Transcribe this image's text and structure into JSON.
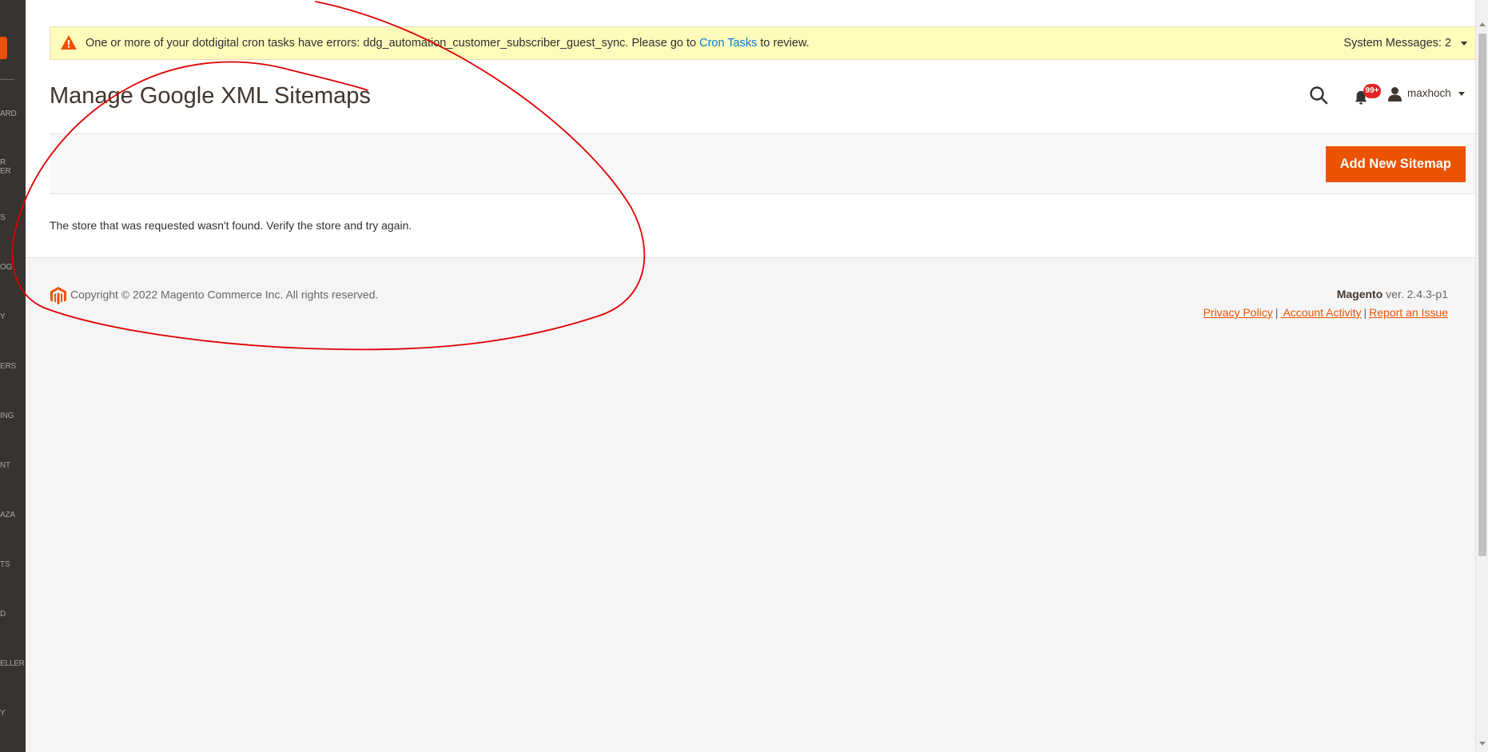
{
  "sidebar": {
    "items": [
      {
        "label": "ARD"
      },
      {
        "label": "R\nER"
      },
      {
        "label": "S"
      },
      {
        "label": "OG"
      },
      {
        "label": "Y"
      },
      {
        "label": "ERS"
      },
      {
        "label": "ING"
      },
      {
        "label": "NT"
      },
      {
        "label": "AZA"
      },
      {
        "label": "TS"
      },
      {
        "label": "D"
      },
      {
        "label": "ELLER"
      },
      {
        "label": "Y"
      }
    ]
  },
  "system_message": {
    "text_before": "One or more of your dotdigital cron tasks have errors: ddg_automation_customer_subscriber_guest_sync. Please go to ",
    "link": "Cron Tasks",
    "text_after": " to review.",
    "count_label": "System Messages: 2"
  },
  "header": {
    "title": "Manage Google XML Sitemaps",
    "notifications_badge": "99+",
    "username": "maxhoch"
  },
  "toolbar": {
    "add_button": "Add New Sitemap"
  },
  "main": {
    "notice": "The store that was requested wasn't found. Verify the store and try again."
  },
  "footer": {
    "copyright": "Copyright © 2022 Magento Commerce Inc. All rights reserved.",
    "brand": "Magento",
    "version": " ver. 2.4.3-p1",
    "links": [
      "Privacy Policy",
      " Account Activity",
      "Report an Issue"
    ]
  },
  "colors": {
    "accent": "#eb5202",
    "link": "#007bdb",
    "sysmsg_bg": "#fffbbb",
    "annotation": "#e00000"
  }
}
